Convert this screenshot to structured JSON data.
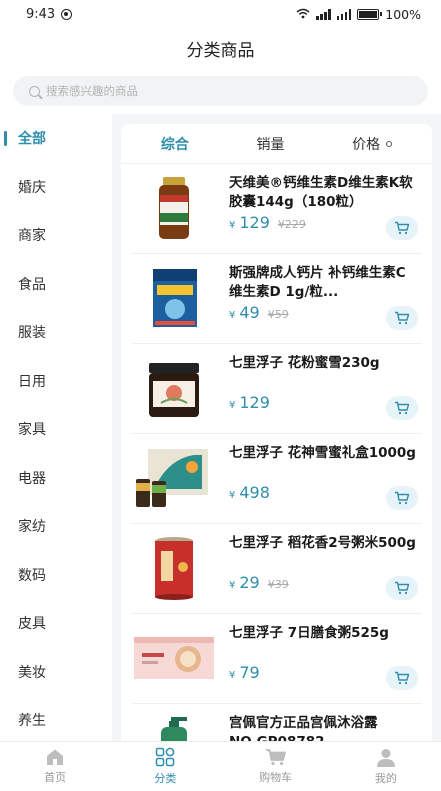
{
  "status_bar": {
    "time": "9:43",
    "battery": "100%",
    "network_1": "4G",
    "network_2": "4G"
  },
  "header": {
    "title": "分类商品"
  },
  "search": {
    "placeholder": "搜索感兴趣的商品"
  },
  "sidebar": {
    "items": [
      {
        "label": "全部",
        "active": true
      },
      {
        "label": "婚庆"
      },
      {
        "label": "商家"
      },
      {
        "label": "食品"
      },
      {
        "label": "服装"
      },
      {
        "label": "日用"
      },
      {
        "label": "家具"
      },
      {
        "label": "电器"
      },
      {
        "label": "家纺"
      },
      {
        "label": "数码"
      },
      {
        "label": "皮具"
      },
      {
        "label": "美妆"
      },
      {
        "label": "养生"
      }
    ]
  },
  "sort": {
    "tabs": [
      {
        "label": "综合",
        "active": true
      },
      {
        "label": "销量"
      },
      {
        "label": "价格"
      }
    ]
  },
  "products": [
    {
      "title": "天维美®钙维生素D维生素K软胶囊144g（180粒）",
      "yen": "¥",
      "price": "129",
      "original": "¥229",
      "thumb": "vitamin-bottle"
    },
    {
      "title": "斯强牌成人钙片 补钙维生素C维生素D 1g/粒...",
      "yen": "¥",
      "price": "49",
      "original": "¥59",
      "thumb": "calcium-box"
    },
    {
      "title": "七里浮子 花粉蜜雪230g",
      "yen": "¥",
      "price": "129",
      "original": "",
      "thumb": "honey-jar"
    },
    {
      "title": "七里浮子 花神雪蜜礼盒1000g",
      "yen": "¥",
      "price": "498",
      "original": "",
      "thumb": "gift-box"
    },
    {
      "title": "七里浮子 稻花香2号粥米500g",
      "yen": "¥",
      "price": "29",
      "original": "¥39",
      "thumb": "rice-can"
    },
    {
      "title": "七里浮子 7日膳食粥525g",
      "yen": "¥",
      "price": "79",
      "original": "",
      "thumb": "porridge-box"
    },
    {
      "title": "宫佩官方正品宫佩沐浴露NO.GP08782",
      "yen": "¥",
      "price": "",
      "original": "",
      "thumb": "shower-gel"
    }
  ],
  "tabbar": {
    "items": [
      {
        "label": "首页",
        "icon": "home-icon"
      },
      {
        "label": "分类",
        "icon": "category-icon",
        "active": true
      },
      {
        "label": "购物车",
        "icon": "cart-icon"
      },
      {
        "label": "我的",
        "icon": "profile-icon"
      }
    ]
  },
  "colors": {
    "accent": "#2f8eac",
    "background": "#f3f5f7"
  }
}
